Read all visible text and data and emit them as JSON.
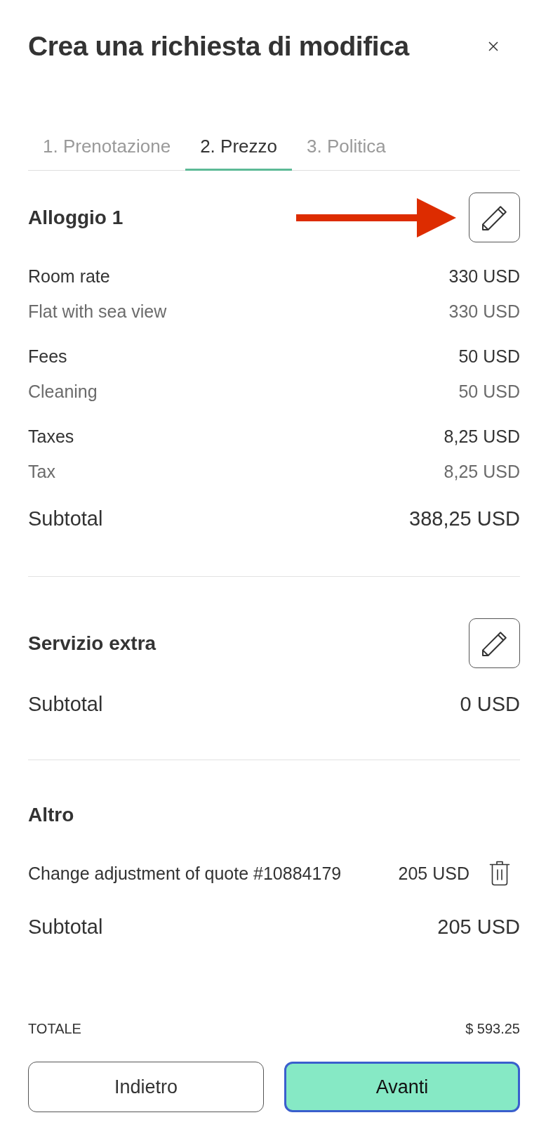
{
  "dialog": {
    "title": "Crea una richiesta di modifica"
  },
  "tabs": [
    {
      "label": "1. Prenotazione",
      "selected": false
    },
    {
      "label": "2. Prezzo",
      "selected": true
    },
    {
      "label": "3. Politica",
      "selected": false
    }
  ],
  "sections": [
    {
      "title": "Alloggio 1",
      "editable": true,
      "pointer_arrow": true,
      "groups": [
        {
          "label": "Room rate",
          "amount": "330 USD",
          "details": [
            {
              "label": "Flat with sea view",
              "amount": "330 USD"
            }
          ]
        },
        {
          "label": "Fees",
          "amount": "50 USD",
          "details": [
            {
              "label": "Cleaning",
              "amount": "50 USD"
            }
          ]
        },
        {
          "label": "Taxes",
          "amount": "8,25 USD",
          "details": [
            {
              "label": "Tax",
              "amount": "8,25 USD"
            }
          ]
        }
      ],
      "subtotal": {
        "label": "Subtotal",
        "amount": "388,25 USD"
      }
    },
    {
      "title": "Servizio extra",
      "editable": true,
      "subtotal": {
        "label": "Subtotal",
        "amount": "0 USD"
      }
    },
    {
      "title": "Altro",
      "items": [
        {
          "label": "Change adjustment of quote #10884179",
          "amount": "205 USD",
          "deletable": true
        }
      ],
      "subtotal": {
        "label": "Subtotal",
        "amount": "205 USD"
      }
    }
  ],
  "total": {
    "label": "TOTALE",
    "amount": "$ 593.25"
  },
  "buttons": [
    {
      "label": "Indietro",
      "kind": "secondary",
      "focused": false
    },
    {
      "label": "Avanti",
      "kind": "primary",
      "focused": true
    }
  ]
}
